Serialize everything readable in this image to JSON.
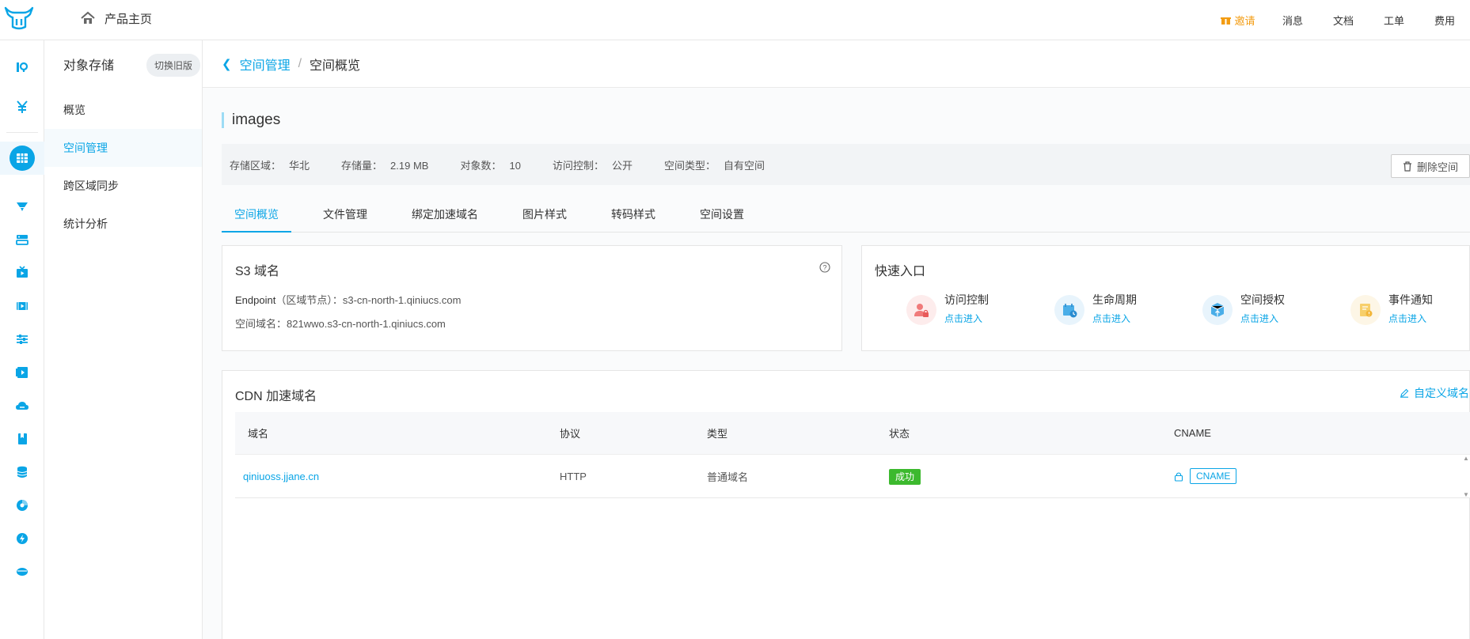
{
  "header": {
    "home_label": "产品主页",
    "nav": [
      {
        "label": "邀请",
        "color": "#f39c12"
      },
      {
        "label": "消息"
      },
      {
        "label": "文档"
      },
      {
        "label": "工单"
      },
      {
        "label": "费用"
      }
    ]
  },
  "sidebar": {
    "title": "对象存储",
    "switch_label": "切换旧版",
    "items": [
      {
        "label": "概览"
      },
      {
        "label": "空间管理",
        "active": true
      },
      {
        "label": "跨区域同步"
      },
      {
        "label": "统计分析"
      }
    ]
  },
  "breadcrumb": {
    "parent": "空间管理",
    "current": "空间概览"
  },
  "bucket": {
    "name": "images",
    "info": [
      {
        "key": "存储区域：",
        "value": "华北"
      },
      {
        "key": "存储量：",
        "value": "2.19 MB"
      },
      {
        "key": "对象数：",
        "value": "10"
      },
      {
        "key": "访问控制：",
        "value": "公开"
      },
      {
        "key": "空间类型：",
        "value": "自有空间"
      }
    ],
    "delete_label": "删除空间"
  },
  "tabs": [
    {
      "label": "空间概览",
      "active": true
    },
    {
      "label": "文件管理"
    },
    {
      "label": "绑定加速域名"
    },
    {
      "label": "图片样式"
    },
    {
      "label": "转码样式"
    },
    {
      "label": "空间设置"
    }
  ],
  "s3": {
    "title": "S3 域名",
    "endpoint_key": "Endpoint",
    "endpoint_note": "（区域节点）：",
    "endpoint_value": "s3-cn-north-1.qiniucs.com",
    "domain_key": "空间域名：",
    "domain_value": "821wwo.s3-cn-north-1.qiniucs.com"
  },
  "quick": {
    "title": "快速入口",
    "items": [
      {
        "label": "访问控制",
        "link": "点击进入",
        "icon": "access-control-icon",
        "bg": "#fdecec"
      },
      {
        "label": "生命周期",
        "link": "点击进入",
        "icon": "lifecycle-icon",
        "bg": "#e8f4fc"
      },
      {
        "label": "空间授权",
        "link": "点击进入",
        "icon": "authorization-icon",
        "bg": "#e8f4fc"
      },
      {
        "label": "事件通知",
        "link": "点击进入",
        "icon": "event-notify-icon",
        "bg": "#fdf6e6"
      }
    ]
  },
  "cdn": {
    "title": "CDN 加速域名",
    "custom_label": "自定义域名",
    "columns": [
      "域名",
      "协议",
      "类型",
      "状态",
      "CNAME"
    ],
    "rows": [
      {
        "domain": "qiniuoss.jjane.cn",
        "protocol": "HTTP",
        "type": "普通域名",
        "status": "成功",
        "cname": "CNAME"
      }
    ]
  },
  "colors": {
    "accent": "#0aa5e6",
    "success": "#3cb92e",
    "invite": "#f39c12"
  }
}
